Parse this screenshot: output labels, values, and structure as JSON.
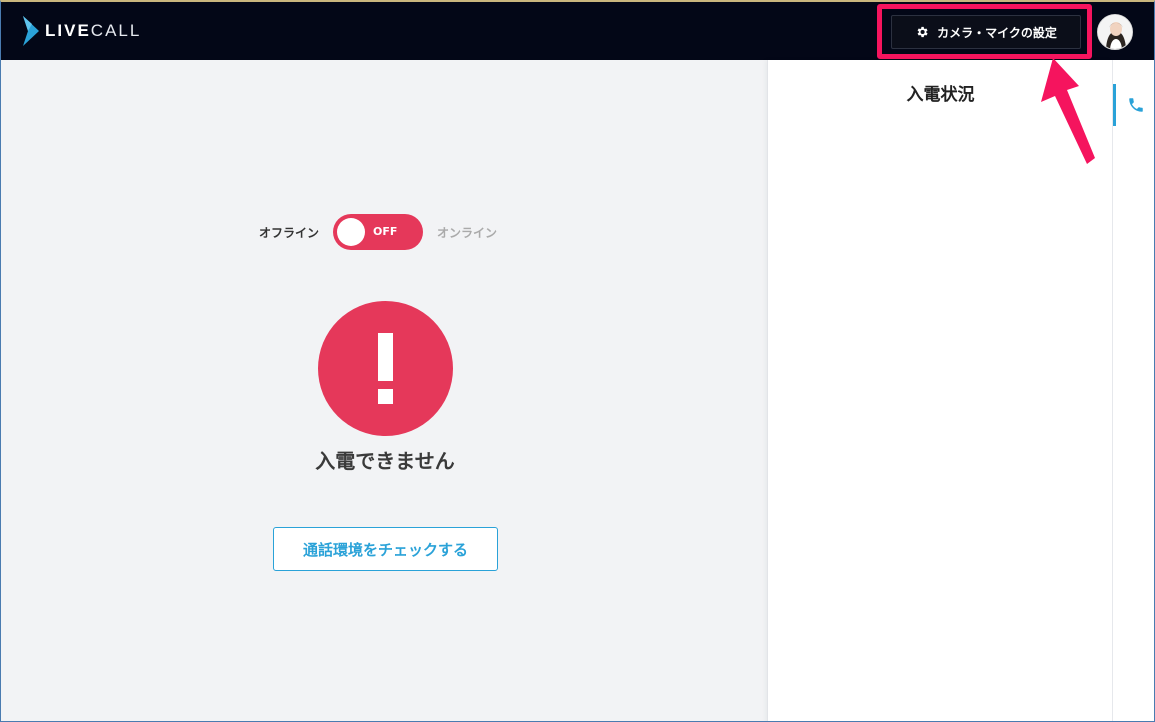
{
  "app": {
    "logo_text_bold": "LIVE",
    "logo_text_light": "CALL",
    "brand_color": "#2aa2d8",
    "alert_color": "#e5385a"
  },
  "header": {
    "settings_button_label": "カメラ・マイクの設定",
    "settings_icon": "gear-icon",
    "avatar_icon": "user-avatar"
  },
  "main": {
    "toggle": {
      "left_label": "オフライン",
      "right_label": "オンライン",
      "state_label": "OFF"
    },
    "alert_icon": "exclamation-icon",
    "status_text": "入電できません",
    "check_button_label": "通話環境をチェックする"
  },
  "side_panel": {
    "title": "入電状況"
  },
  "side_rail": {
    "tab_icon": "phone-icon"
  },
  "annotation": {
    "highlight_color": "#f5145e"
  }
}
